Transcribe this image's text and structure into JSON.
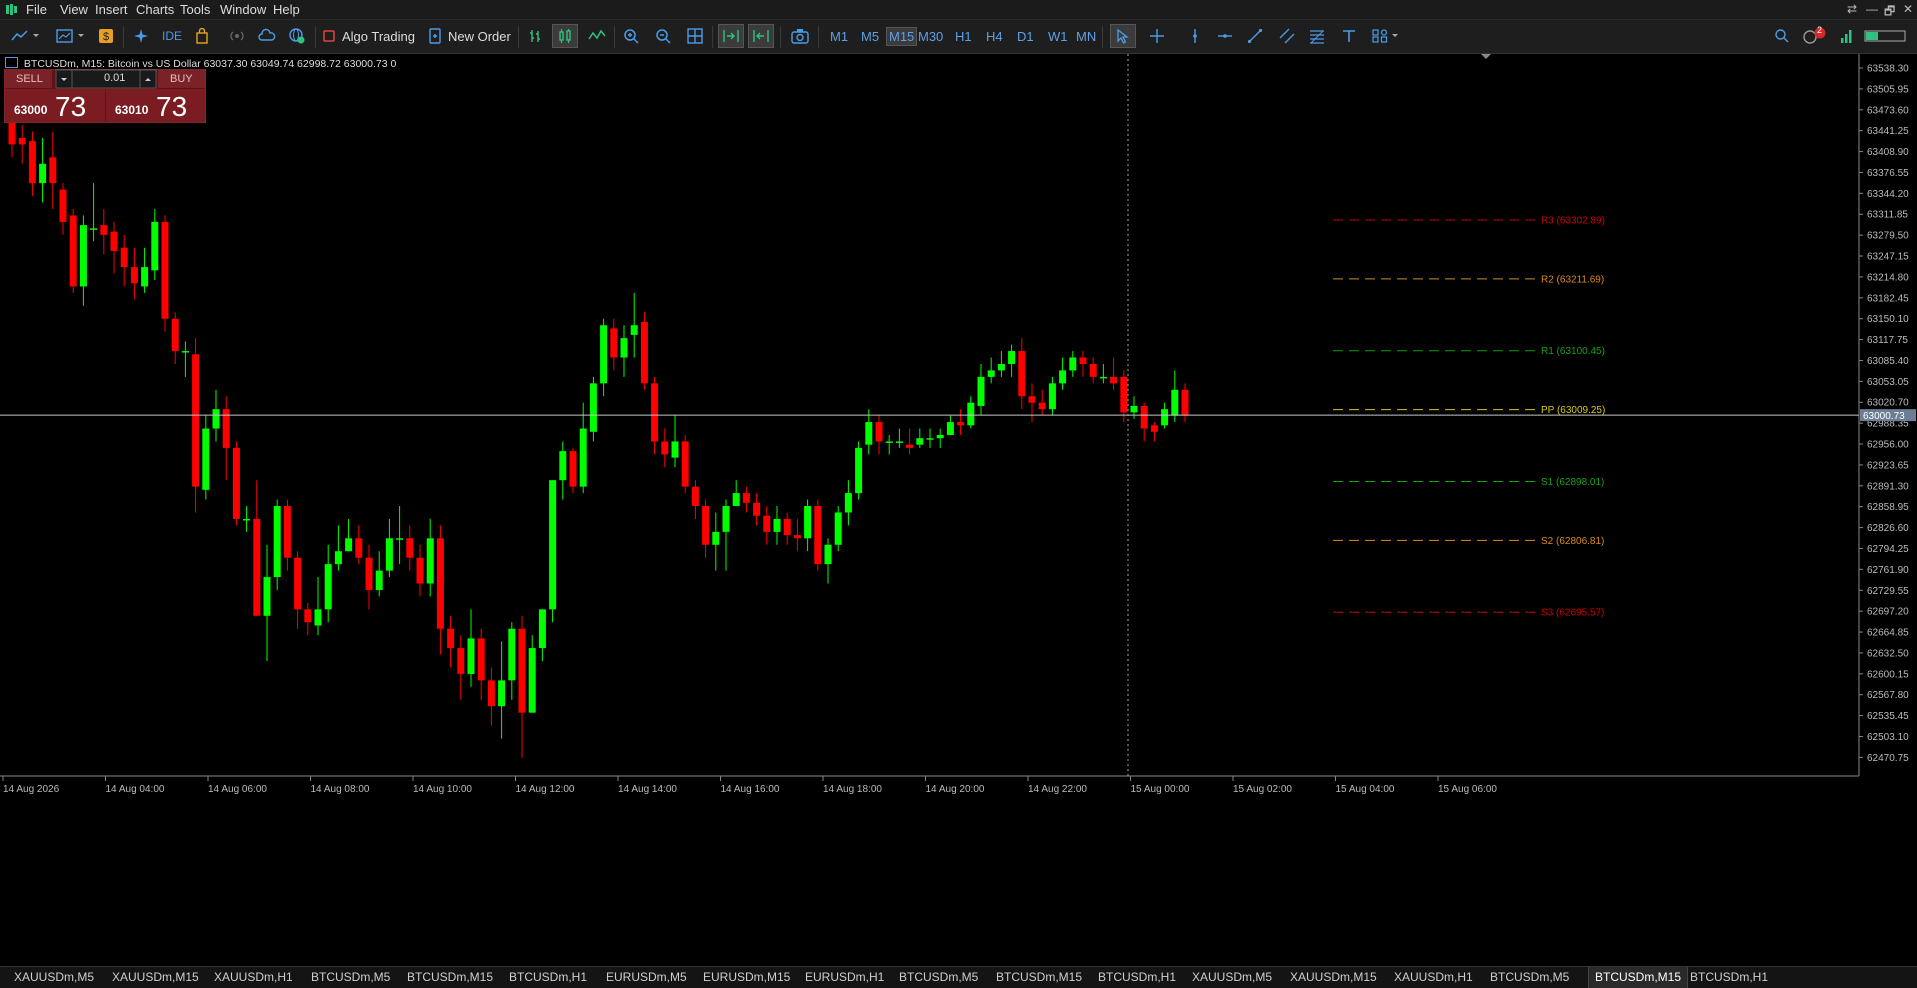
{
  "menubar": {
    "items": [
      "File",
      "View",
      "Insert",
      "Charts",
      "Tools",
      "Window",
      "Help"
    ],
    "window_controls": [
      "⇄",
      "—",
      "🗗",
      "✕"
    ]
  },
  "toolbar": {
    "algo_trading_label": "Algo Trading",
    "new_order_label": "New Order",
    "ide_label": "IDE",
    "timeframes": [
      "M1",
      "M5",
      "M15",
      "M30",
      "H1",
      "H4",
      "D1",
      "W1",
      "MN"
    ],
    "active_timeframe": "M15",
    "notification_count": "2"
  },
  "chart_header": {
    "text": "BTCUSDm, M15:  Bitcoin vs US Dollar  63037.30 63049.74 62998.72 63000.73  0"
  },
  "trade_panel": {
    "sell_label": "SELL",
    "buy_label": "BUY",
    "volume": "0.01",
    "sell_price_small": "63000",
    "sell_price_big": "73",
    "buy_price_small": "63010",
    "buy_price_big": "73"
  },
  "chart_data": {
    "type": "candlestick",
    "symbol": "BTCUSDm",
    "timeframe": "M15",
    "ylim": [
      62445,
      63560
    ],
    "current_price": 63000.73,
    "current_price_label": "63000.73",
    "price_ticks": [
      "63538.30",
      "63505.95",
      "63473.60",
      "63441.25",
      "63408.90",
      "63376.55",
      "63344.20",
      "63311.85",
      "63279.50",
      "63247.15",
      "63214.80",
      "63182.45",
      "63150.10",
      "63117.75",
      "63085.40",
      "63053.05",
      "63020.70",
      "62988.35",
      "62956.00",
      "62923.65",
      "62891.30",
      "62858.95",
      "62826.60",
      "62794.25",
      "62761.90",
      "62729.55",
      "62697.20",
      "62664.85",
      "62632.50",
      "62600.15",
      "62567.80",
      "62535.45",
      "62503.10",
      "62470.75"
    ],
    "time_labels": [
      "14 Aug 2026",
      "14 Aug 04:00",
      "14 Aug 06:00",
      "14 Aug 08:00",
      "14 Aug 10:00",
      "14 Aug 12:00",
      "14 Aug 14:00",
      "14 Aug 16:00",
      "14 Aug 18:00",
      "14 Aug 20:00",
      "14 Aug 22:00",
      "15 Aug 00:00",
      "15 Aug 02:00",
      "15 Aug 04:00",
      "15 Aug 06:00"
    ],
    "pivots": [
      {
        "label": "R3 (63302.89)",
        "value": 63302.89,
        "color": "#cc0000"
      },
      {
        "label": "R2 (63211.69)",
        "value": 63211.69,
        "color": "#d98a1c"
      },
      {
        "label": "R1 (63100.45)",
        "value": 63100.45,
        "color": "#16a016"
      },
      {
        "label": "PP (63009.25)",
        "value": 63009.25,
        "color": "#d8c818"
      },
      {
        "label": "S1 (62898.01)",
        "value": 62898.01,
        "color": "#16a016"
      },
      {
        "label": "S2 (62806.81)",
        "value": 62806.81,
        "color": "#d98a1c"
      },
      {
        "label": "S3 (62695.57)",
        "value": 62695.57,
        "color": "#cc0000"
      }
    ],
    "candles": [
      [
        63460,
        63420,
        63470,
        63400
      ],
      [
        63430,
        63420,
        63450,
        63390
      ],
      [
        63425,
        63360,
        63440,
        63340
      ],
      [
        63360,
        63390,
        63430,
        63330
      ],
      [
        63400,
        63360,
        63440,
        63320
      ],
      [
        63350,
        63300,
        63360,
        63280
      ],
      [
        63310,
        63200,
        63320,
        63190
      ],
      [
        63200,
        63295,
        63310,
        63170
      ],
      [
        63290,
        63290,
        63360,
        63270
      ],
      [
        63295,
        63280,
        63320,
        63250
      ],
      [
        63285,
        63255,
        63300,
        63220
      ],
      [
        63260,
        63230,
        63280,
        63200
      ],
      [
        63230,
        63205,
        63260,
        63180
      ],
      [
        63200,
        63230,
        63260,
        63190
      ],
      [
        63225,
        63300,
        63320,
        63210
      ],
      [
        63300,
        63150,
        63310,
        63130
      ],
      [
        63150,
        63100,
        63160,
        63080
      ],
      [
        63100,
        63100,
        63115,
        63060
      ],
      [
        63095,
        62890,
        63120,
        62850
      ],
      [
        62885,
        62980,
        63000,
        62870
      ],
      [
        62980,
        63010,
        63040,
        62960
      ],
      [
        63010,
        62950,
        63030,
        62900
      ],
      [
        62950,
        62840,
        62960,
        62830
      ],
      [
        62840,
        62840,
        62860,
        62820
      ],
      [
        62840,
        62690,
        62900,
        62690
      ],
      [
        62690,
        62750,
        62800,
        62620
      ],
      [
        62750,
        62860,
        62870,
        62730
      ],
      [
        62860,
        62780,
        62870,
        62760
      ],
      [
        62780,
        62700,
        62790,
        62670
      ],
      [
        62700,
        62680,
        62710,
        62660
      ],
      [
        62675,
        62700,
        62750,
        62660
      ],
      [
        62700,
        62770,
        62800,
        62680
      ],
      [
        62770,
        62790,
        62830,
        62760
      ],
      [
        62790,
        62810,
        62840,
        62790
      ],
      [
        62810,
        62780,
        62830,
        62770
      ],
      [
        62780,
        62730,
        62800,
        62700
      ],
      [
        62730,
        62760,
        62790,
        62720
      ],
      [
        62760,
        62810,
        62840,
        62750
      ],
      [
        62810,
        62810,
        62860,
        62770
      ],
      [
        62810,
        62780,
        62830,
        62760
      ],
      [
        62780,
        62740,
        62800,
        62720
      ],
      [
        62740,
        62810,
        62840,
        62720
      ],
      [
        62810,
        62670,
        62830,
        62630
      ],
      [
        62670,
        62640,
        62690,
        62610
      ],
      [
        62640,
        62600,
        62660,
        62560
      ],
      [
        62600,
        62655,
        62700,
        62580
      ],
      [
        62655,
        62590,
        62670,
        62560
      ],
      [
        62590,
        62550,
        62610,
        62520
      ],
      [
        62550,
        62590,
        62650,
        62500
      ],
      [
        62590,
        62670,
        62680,
        62560
      ],
      [
        62670,
        62540,
        62690,
        62470
      ],
      [
        62540,
        62640,
        62660,
        62540
      ],
      [
        62640,
        62700,
        62700,
        62620
      ],
      [
        62700,
        62900,
        62900,
        62680
      ],
      [
        62900,
        62945,
        62960,
        62870
      ],
      [
        62945,
        62890,
        62950,
        62880
      ],
      [
        62890,
        62980,
        63020,
        62880
      ],
      [
        62975,
        63050,
        63060,
        62960
      ],
      [
        63050,
        63140,
        63150,
        63030
      ],
      [
        63135,
        63090,
        63150,
        63070
      ],
      [
        63090,
        63120,
        63140,
        63060
      ],
      [
        63125,
        63140,
        63190,
        63090
      ],
      [
        63145,
        63050,
        63160,
        63040
      ],
      [
        63050,
        62960,
        63060,
        62940
      ],
      [
        62960,
        62940,
        62980,
        62920
      ],
      [
        62935,
        62960,
        63000,
        62920
      ],
      [
        62960,
        62890,
        62970,
        62880
      ],
      [
        62890,
        62860,
        62900,
        62840
      ],
      [
        62860,
        62800,
        62870,
        62780
      ],
      [
        62800,
        62820,
        62850,
        62760
      ],
      [
        62820,
        62860,
        62870,
        62760
      ],
      [
        62860,
        62880,
        62900,
        62860
      ],
      [
        62880,
        62865,
        62890,
        62850
      ],
      [
        62865,
        62845,
        62880,
        62830
      ],
      [
        62845,
        62820,
        62860,
        62800
      ],
      [
        62820,
        62840,
        62860,
        62800
      ],
      [
        62840,
        62815,
        62850,
        62800
      ],
      [
        62815,
        62810,
        62840,
        62790
      ],
      [
        62810,
        62860,
        62870,
        62790
      ],
      [
        62860,
        62770,
        62870,
        62760
      ],
      [
        62770,
        62800,
        62810,
        62740
      ],
      [
        62800,
        62850,
        62860,
        62790
      ],
      [
        62850,
        62880,
        62900,
        62830
      ],
      [
        62880,
        62950,
        62960,
        62870
      ],
      [
        62955,
        62990,
        63010,
        62940
      ],
      [
        62990,
        62960,
        63000,
        62940
      ],
      [
        62960,
        62960,
        62970,
        62940
      ],
      [
        62960,
        62960,
        62980,
        62950
      ],
      [
        62955,
        62950,
        62980,
        62940
      ],
      [
        62955,
        62965,
        62980,
        62950
      ],
      [
        62965,
        62965,
        62980,
        62950
      ],
      [
        62965,
        62970,
        62980,
        62950
      ],
      [
        62970,
        62990,
        63000,
        62970
      ],
      [
        62990,
        62985,
        63010,
        62970
      ],
      [
        62985,
        63020,
        63030,
        62980
      ],
      [
        63015,
        63060,
        63080,
        63000
      ],
      [
        63060,
        63070,
        63090,
        63050
      ],
      [
        63070,
        63080,
        63100,
        63060
      ],
      [
        63080,
        63100,
        63110,
        63060
      ],
      [
        63100,
        63030,
        63120,
        63010
      ],
      [
        63030,
        63020,
        63050,
        62990
      ],
      [
        63020,
        63010,
        63040,
        63000
      ],
      [
        63010,
        63050,
        63060,
        63000
      ],
      [
        63050,
        63070,
        63090,
        63040
      ],
      [
        63070,
        63090,
        63100,
        63060
      ],
      [
        63090,
        63080,
        63100,
        63060
      ],
      [
        63080,
        63060,
        63090,
        63050
      ],
      [
        63060,
        63060,
        63080,
        63050
      ],
      [
        63060,
        63050,
        63090,
        63040
      ],
      [
        63060,
        63005,
        63070,
        62990
      ],
      [
        63005,
        63015,
        63030,
        62995
      ],
      [
        63015,
        62980,
        63020,
        62960
      ],
      [
        62985,
        62975,
        62990,
        62960
      ],
      [
        62985,
        63010,
        63020,
        62980
      ],
      [
        63000,
        63040,
        63070,
        62990
      ],
      [
        63040,
        63000,
        63050,
        62990
      ]
    ]
  },
  "tabs": {
    "items": [
      "XAUUSDm,M5",
      "XAUUSDm,M15",
      "XAUUSDm,H1",
      "BTCUSDm,M5",
      "BTCUSDm,M15",
      "BTCUSDm,H1",
      "EURUSDm,M5",
      "EURUSDm,M15",
      "EURUSDm,H1",
      "BTCUSDm,M5",
      "BTCUSDm,M15",
      "BTCUSDm,H1",
      "XAUUSDm,M5",
      "XAUUSDm,M15",
      "XAUUSDm,H1",
      "BTCUSDm,M5",
      "BTCUSDm,M15",
      "BTCUSDm,H1"
    ],
    "active_index": 16
  },
  "colors": {
    "bull": "#00ff00",
    "bear": "#ff0000",
    "background": "#000000",
    "price_line": "#c8c8c8",
    "accent": "#4a9be8"
  }
}
